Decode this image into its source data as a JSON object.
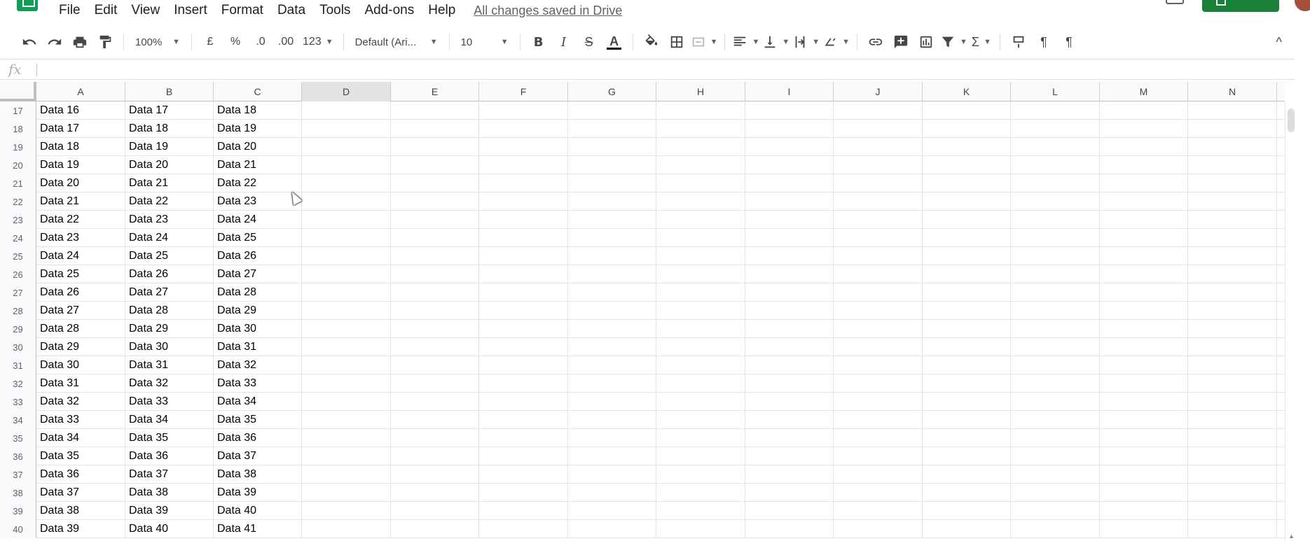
{
  "menu": {
    "items": [
      "File",
      "Edit",
      "View",
      "Insert",
      "Format",
      "Data",
      "Tools",
      "Add-ons",
      "Help"
    ],
    "saved_status": "All changes saved in Drive"
  },
  "toolbar": {
    "zoom": "100%",
    "currency": "£",
    "percent": "%",
    "decrease_decimal": ".0",
    "increase_decimal": ".00",
    "more_formats": "123",
    "font": "Default (Ari...",
    "font_size": "10",
    "bold": "B",
    "italic": "I",
    "strikethrough": "S",
    "text_color": "A",
    "sigma": "Σ",
    "pilcrow": "¶",
    "collapse": "^"
  },
  "formula_bar": {
    "fx": "fx",
    "value": ""
  },
  "grid": {
    "columns": [
      "A",
      "B",
      "C",
      "D",
      "E",
      "F",
      "G",
      "H",
      "I",
      "J",
      "K",
      "L",
      "M",
      "N"
    ],
    "active_column": "D",
    "rows": [
      {
        "n": "17",
        "a": "Data 16",
        "b": "Data 17",
        "c": "Data 18"
      },
      {
        "n": "18",
        "a": "Data 17",
        "b": "Data 18",
        "c": "Data 19"
      },
      {
        "n": "19",
        "a": "Data 18",
        "b": "Data 19",
        "c": "Data 20"
      },
      {
        "n": "20",
        "a": "Data 19",
        "b": "Data 20",
        "c": "Data 21"
      },
      {
        "n": "21",
        "a": "Data 20",
        "b": "Data 21",
        "c": "Data 22"
      },
      {
        "n": "22",
        "a": "Data 21",
        "b": "Data 22",
        "c": "Data 23"
      },
      {
        "n": "23",
        "a": "Data 22",
        "b": "Data 23",
        "c": "Data 24"
      },
      {
        "n": "24",
        "a": "Data 23",
        "b": "Data 24",
        "c": "Data 25"
      },
      {
        "n": "25",
        "a": "Data 24",
        "b": "Data 25",
        "c": "Data 26"
      },
      {
        "n": "26",
        "a": "Data 25",
        "b": "Data 26",
        "c": "Data 27"
      },
      {
        "n": "27",
        "a": "Data 26",
        "b": "Data 27",
        "c": "Data 28"
      },
      {
        "n": "28",
        "a": "Data 27",
        "b": "Data 28",
        "c": "Data 29"
      },
      {
        "n": "29",
        "a": "Data 28",
        "b": "Data 29",
        "c": "Data 30"
      },
      {
        "n": "30",
        "a": "Data 29",
        "b": "Data 30",
        "c": "Data 31"
      },
      {
        "n": "31",
        "a": "Data 30",
        "b": "Data 31",
        "c": "Data 32"
      },
      {
        "n": "32",
        "a": "Data 31",
        "b": "Data 32",
        "c": "Data 33"
      },
      {
        "n": "33",
        "a": "Data 32",
        "b": "Data 33",
        "c": "Data 34"
      },
      {
        "n": "34",
        "a": "Data 33",
        "b": "Data 34",
        "c": "Data 35"
      },
      {
        "n": "35",
        "a": "Data 34",
        "b": "Data 35",
        "c": "Data 36"
      },
      {
        "n": "36",
        "a": "Data 35",
        "b": "Data 36",
        "c": "Data 37"
      },
      {
        "n": "37",
        "a": "Data 36",
        "b": "Data 37",
        "c": "Data 38"
      },
      {
        "n": "38",
        "a": "Data 37",
        "b": "Data 38",
        "c": "Data 39"
      },
      {
        "n": "39",
        "a": "Data 38",
        "b": "Data 39",
        "c": "Data 40"
      },
      {
        "n": "40",
        "a": "Data 39",
        "b": "Data 40",
        "c": "Data 41"
      }
    ]
  },
  "icons": {
    "app": "sheets-logo-icon",
    "undo": "undo-icon",
    "redo": "redo-icon",
    "print": "print-icon",
    "paint_format": "paint-format-icon",
    "fill": "fill-color-icon",
    "borders": "borders-icon",
    "merge": "merge-cells-icon",
    "align": "horizontal-align-icon",
    "valign": "vertical-align-icon",
    "wrap": "text-wrap-icon",
    "rotate": "text-rotation-icon",
    "link": "link-icon",
    "comment": "insert-comment-icon",
    "chart": "insert-chart-icon",
    "filter": "filter-icon",
    "functions": "functions-icon"
  },
  "colors": {
    "brand_green": "#0f9d58",
    "share_green": "#188038",
    "header_bg": "#f8f9fa",
    "active_header_bg": "#e2e3e3",
    "grid_line": "#e2e2e2"
  }
}
